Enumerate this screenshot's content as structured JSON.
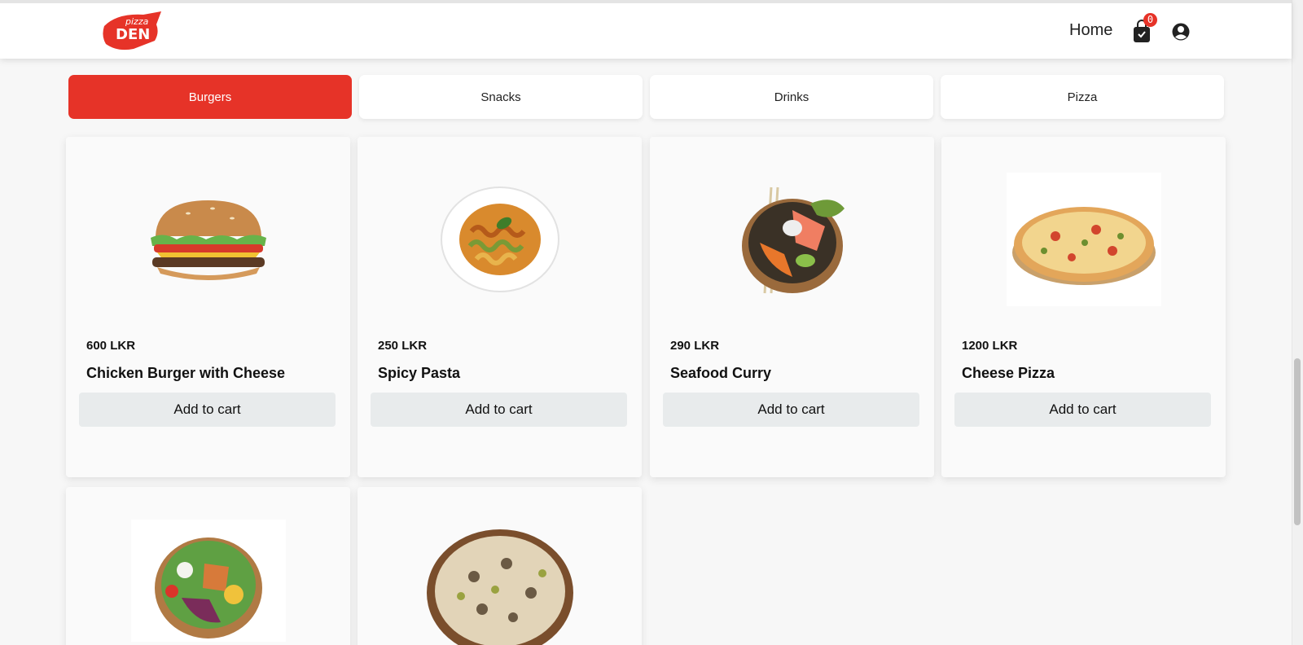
{
  "header": {
    "logo_top": "pizza",
    "logo_bottom": "DEN",
    "nav_home": "Home",
    "cart_count": "0",
    "brand_color": "#e63328"
  },
  "categories": [
    {
      "label": "Burgers",
      "active": true
    },
    {
      "label": "Snacks",
      "active": false
    },
    {
      "label": "Drinks",
      "active": false
    },
    {
      "label": "Pizza",
      "active": false
    }
  ],
  "products": [
    {
      "price": "600 LKR",
      "name": "Chicken Burger with Cheese",
      "button": "Add to cart",
      "image": "burger-image"
    },
    {
      "price": "250 LKR",
      "name": "Spicy Pasta",
      "button": "Add to cart",
      "image": "pasta-image"
    },
    {
      "price": "290 LKR",
      "name": "Seafood Curry",
      "button": "Add to cart",
      "image": "curry-bowl-image"
    },
    {
      "price": "1200 LKR",
      "name": "Cheese Pizza",
      "button": "Add to cart",
      "image": "pizza-image"
    },
    {
      "image": "salad-bowl-image"
    },
    {
      "image": "mushroom-pizza-image"
    }
  ]
}
